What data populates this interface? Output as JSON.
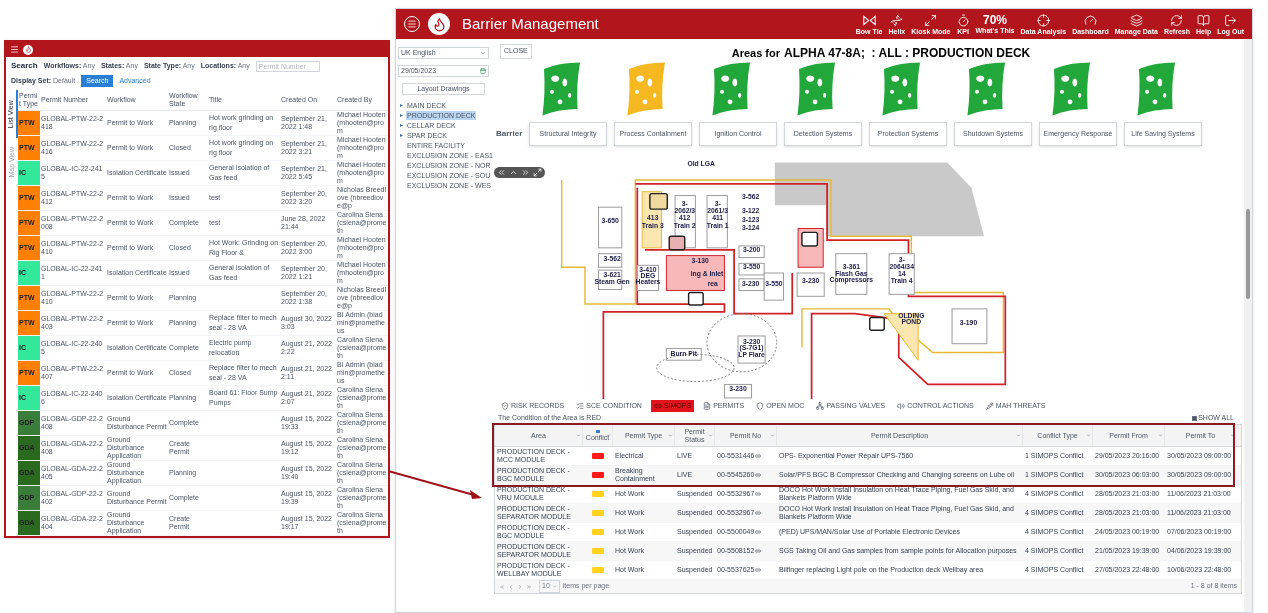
{
  "inset": {
    "search_label": "Search",
    "filters": [
      {
        "label": "Workflows:",
        "value": "Any"
      },
      {
        "label": "States:",
        "value": "Any"
      },
      {
        "label": "State Type:",
        "value": "Any"
      },
      {
        "label": "Locations:",
        "value": "Any"
      }
    ],
    "permit_number": {
      "placeholder": "Permit Number"
    },
    "display_set": {
      "label": "Display Set:",
      "value": "Default"
    },
    "search_button": "Search",
    "advanced_link": "Advanced",
    "side_tabs": [
      {
        "label": "List View",
        "selected": true
      },
      {
        "label": "Map View",
        "selected": false
      }
    ],
    "columns": [
      "Permit Type",
      "Permit Number",
      "Workflow",
      "Workflow State",
      "Title",
      "Created On",
      "Created By"
    ],
    "rows": [
      {
        "type": "PTW",
        "color": "#ff8000",
        "number": "GLOBAL-PTW-22-2418",
        "workflow": "Permit to Work",
        "state": "Planning",
        "title": "Hot work grinding on rig floor",
        "created": "September 21, 2022 1:48",
        "by": "Michael Hooten (mhooten@prom"
      },
      {
        "type": "PTW",
        "color": "#ff8000",
        "number": "GLOBAL-PTW-22-2416",
        "workflow": "Permit to Work",
        "state": "Closed",
        "title": "Hot work grinding on rig floor",
        "created": "September 21, 2022 3:21",
        "by": "Michael Hooten (mhooten@prom"
      },
      {
        "type": "IC",
        "color": "#33e89a",
        "number": "GLOBAL-IC-22-2415",
        "workflow": "Isolation Certificate",
        "state": "Issued",
        "title": "General isolation of Gas feed",
        "created": "September 21, 2022 5:45",
        "by": "Michael Hooten (mhooten@prom"
      },
      {
        "type": "PTW",
        "color": "#ff8000",
        "number": "GLOBAL-PTW-22-2412",
        "workflow": "Permit to Work",
        "state": "Issued",
        "title": "test",
        "created": "September 20, 2022 3:20",
        "by": "Nicholas Breedlove (nbreedlove@p"
      },
      {
        "type": "PTW",
        "color": "#ff8000",
        "number": "GLOBAL-PTW-22-2008",
        "workflow": "Permit to Work",
        "state": "Complete",
        "title": "test",
        "created": "June 28, 2022 21:44",
        "by": "Carolina Siena (csiena@prometh"
      },
      {
        "type": "PTW",
        "color": "#ff8000",
        "number": "GLOBAL-PTW-22-2410",
        "workflow": "Permit to Work",
        "state": "Closed",
        "title": "Hot Work: Grinding on Rig Floor &",
        "created": "September 20, 2022 3:00",
        "by": "Michael Hooten (mhooten@prom"
      },
      {
        "type": "IC",
        "color": "#33e89a",
        "number": "GLOBAL-IC-22-2411",
        "workflow": "Isolation Certificate",
        "state": "Issued",
        "title": "General isolation of Gas feed",
        "created": "September 20, 2022 1:21",
        "by": "Michael Hooten (mhooten@prom"
      },
      {
        "type": "PTW",
        "color": "#ff8000",
        "number": "GLOBAL-PTW-22-2410",
        "workflow": "Permit to Work",
        "state": "Planning",
        "title": "",
        "created": "September 20, 2022 1:38",
        "by": "Nicholas Breedlove (nbreedlove@p"
      },
      {
        "type": "PTW",
        "color": "#ff8000",
        "number": "GLOBAL-PTW-22-2403",
        "workflow": "Permit to Work",
        "state": "Planning",
        "title": "Replace filter to mech seal - 28 VA",
        "created": "August 30, 2022 3:03",
        "by": "BI Admin (biadmin@prometheus"
      },
      {
        "type": "IC",
        "color": "#33e89a",
        "number": "GLOBAL-IC-22-2405",
        "workflow": "Isolation Certificate",
        "state": "Complete",
        "title": "Electric pump relocation",
        "created": "August 21, 2022 2:22",
        "by": "Carolina Siena (csiena@prometh"
      },
      {
        "type": "PTW",
        "color": "#ff8000",
        "number": "GLOBAL-PTW-22-2407",
        "workflow": "Permit to Work",
        "state": "Closed",
        "title": "Replace filter to mech seal - 28 VA",
        "created": "August 21, 2022 2:11",
        "by": "BI Admin (biadmin@prometheus"
      },
      {
        "type": "IC",
        "color": "#33e89a",
        "number": "GLOBAL-IC-22-2406",
        "workflow": "Isolation Certificate",
        "state": "Planning",
        "title": "Board 61: Floor Sump Pumps",
        "created": "August 21, 2022 2:07",
        "by": "Carolina Siena (csiena@prometh"
      },
      {
        "type": "GDP",
        "color": "#3a7d3a",
        "number": "GLOBAL-GDP-22-2408",
        "workflow": "Ground Disturbance Permit",
        "state": "Complete",
        "title": "",
        "created": "August 15, 2022 19:33",
        "by": "Carolina Siena (csiena@prometh"
      },
      {
        "type": "GDA",
        "color": "#2a6a1e",
        "number": "GLOBAL-GDA-22-2408",
        "workflow": "Ground Disturbance Application",
        "state": "Create Permit",
        "title": "",
        "created": "August 15, 2022 19:12",
        "by": "Carolina Siena (csiena@prometh"
      },
      {
        "type": "GDA",
        "color": "#2a6a1e",
        "number": "GLOBAL-GDA-22-2405",
        "workflow": "Ground Disturbance Application",
        "state": "Planning",
        "title": "",
        "created": "August 15, 2022 19:40",
        "by": "Carolina Siena (csiena@prometh"
      },
      {
        "type": "GDP",
        "color": "#3a7d3a",
        "number": "GLOBAL-GDP-22-2402",
        "workflow": "Ground Disturbance Permit",
        "state": "Complete",
        "title": "",
        "created": "August 15, 2022 19:39",
        "by": "Carolina Siena (csiena@prometh"
      },
      {
        "type": "GDA",
        "color": "#2a6a1e",
        "number": "GLOBAL-GDA-22-2404",
        "workflow": "Ground Disturbance Application",
        "state": "Create Permit",
        "title": "",
        "created": "August 15, 2022 19:17",
        "by": "Carolina Siena (csiena@prometh"
      }
    ]
  },
  "app": {
    "title": "Barrier Management",
    "toolbar": [
      {
        "kind": "icon",
        "label": "Bow Tie"
      },
      {
        "kind": "icon",
        "label": "Helix"
      },
      {
        "kind": "icon",
        "label": "Kiosk Mode"
      },
      {
        "kind": "icon",
        "label": "KPI"
      },
      {
        "kind": "value",
        "value": "70%",
        "label": "What's This"
      },
      {
        "kind": "icon",
        "label": "Data Analysis"
      },
      {
        "kind": "icon",
        "label": "Dashboard"
      },
      {
        "kind": "icon",
        "label": "Manage Data"
      },
      {
        "kind": "icon",
        "label": "Refresh"
      },
      {
        "kind": "icon",
        "label": "Help"
      },
      {
        "kind": "icon",
        "label": "Log Out"
      }
    ]
  },
  "sidebar": {
    "language": "UK English",
    "date": "29/05/2023",
    "layout_button": "Layout Drawings",
    "tree": [
      {
        "label": "MAIN DECK",
        "has_children": true,
        "selected": false
      },
      {
        "label": "PRODUCTION DECK",
        "has_children": true,
        "selected": true
      },
      {
        "label": "CELLAR DECK",
        "has_children": true,
        "selected": false
      },
      {
        "label": "SPAR DECK",
        "has_children": true,
        "selected": false
      },
      {
        "label": "ENTIRE FACILITY",
        "has_children": false,
        "selected": false
      },
      {
        "label": "EXCLUSION ZONE - EAS1",
        "has_children": false,
        "selected": false
      },
      {
        "label": "EXCLUSION ZONE - NOR",
        "has_children": false,
        "selected": false
      },
      {
        "label": "EXCLUSION ZONE - SOU",
        "has_children": false,
        "selected": false
      },
      {
        "label": "EXCLUSION ZONE - WES",
        "has_children": false,
        "selected": false
      }
    ]
  },
  "areas": {
    "close_button": "CLOSE",
    "title_prefix": "Areas for",
    "title": "ALPHA 47-8A;  : ALL : PRODUCTION DECK",
    "barrier_label": "Barrier",
    "barriers": [
      {
        "label": "Structural Integrity",
        "color": "#22a83a"
      },
      {
        "label": "Process Containment",
        "color": "#f5b820"
      },
      {
        "label": "Ignition Control",
        "color": "#22a83a"
      },
      {
        "label": "Detection Systems",
        "color": "#22a83a"
      },
      {
        "label": "Protection Systems",
        "color": "#22a83a"
      },
      {
        "label": "Shutdown Systems",
        "color": "#22a83a"
      },
      {
        "label": "Emergency Response",
        "color": "#22a83a"
      },
      {
        "label": "Life Saving Systems",
        "color": "#22a83a"
      }
    ]
  },
  "map_labels": [
    "Old LGA",
    "3-650",
    "413",
    "Train 3",
    "3-",
    "2062/3",
    "412",
    "Train 2",
    "3-",
    "2061/3",
    "411",
    "Train 1",
    "3-562",
    "3-122",
    "3-123",
    "3-124",
    "3-200",
    "3-550",
    "3-230",
    "3-550",
    "3-230",
    "3-562",
    "3-621",
    "Steam Gen",
    "3-410",
    "DEG",
    "Heaters",
    "3-130",
    "ing & Inlet",
    "rea",
    "3-361",
    "Flash Gas",
    "Compressors",
    "3-",
    "2064/34",
    "14",
    "Train 4",
    "OLDING",
    "POND",
    "3-190",
    "Burn Pit",
    "3-230",
    "(S-7G1)",
    "LP Flare",
    "3-230"
  ],
  "tabs": [
    {
      "label": "RISK RECORDS",
      "selected": false
    },
    {
      "label": "SCE CONDITION",
      "selected": false
    },
    {
      "label": "SIMOPS",
      "selected": true
    },
    {
      "label": "PERMITS",
      "selected": false
    },
    {
      "label": "OPEN MOC",
      "selected": false
    },
    {
      "label": "PASSING VALVES",
      "selected": false
    },
    {
      "label": "CONTROL ACTIONS",
      "selected": false
    },
    {
      "label": "MAH THREATS",
      "selected": false
    }
  ],
  "condition_text": "The Condition of the Area is RED",
  "show_all": {
    "label": "SHOW ALL",
    "checked": true
  },
  "table": {
    "columns": [
      "Area",
      "Conflict",
      "Permit Type",
      "Permit Status",
      "Permit No",
      "Permit Description",
      "Conflict Type",
      "Permit From",
      "Permit To"
    ],
    "rows": [
      {
        "area": "PRODUCTION DECK - MCC MODULE",
        "color": "#ff1a1a",
        "type": "Electrical",
        "status": "LIVE",
        "no": "00-5531446",
        "desc": "OPS- Exponential Power Repair UPS-7560",
        "conflict": "1 SIMOPS Conflict",
        "from": "29/05/2023 20:16:00",
        "to": "30/05/2023 09:00:00"
      },
      {
        "area": "PRODUCTION DECK - BGC MODULE",
        "color": "#ff1a1a",
        "type": "Breaking Containment",
        "status": "LIVE",
        "no": "00-5545260",
        "desc": "Solar/PFS BGC B Compressor Checking and Changing screens on Lube oil",
        "conflict": "1 SIMOPS Conflict",
        "from": "30/05/2023 06:03:00",
        "to": "30/05/2023 09:00:00"
      },
      {
        "area": "PRODUCTION DECK - VRU MODULE",
        "color": "#ffd21f",
        "type": "Hot Work",
        "status": "Suspended",
        "no": "00-5532967",
        "desc": "DOCO Hot Work Install Insulation on Heat Trace Piping, Fuel Gas Skid, and Blankets Platform Wide",
        "conflict": "4 SIMOPS Conflict",
        "from": "28/05/2023 21:03:00",
        "to": "11/06/2023 21:03:00"
      },
      {
        "area": "PRODUCTION DECK - SEPARATOR MODULE",
        "color": "#ffd21f",
        "type": "Hot Work",
        "status": "Suspended",
        "no": "00-5532967",
        "desc": "DOCO Hot Work Install Insulation on Heat Trace Piping, Fuel Gas Skid, and Blankets Platform Wide",
        "conflict": "4 SIMOPS Conflict",
        "from": "28/05/2023 21:03:00",
        "to": "11/06/2023 21:03:00"
      },
      {
        "area": "PRODUCTION DECK - BGC MODULE",
        "color": "#ffd21f",
        "type": "Hot Work",
        "status": "Suspended",
        "no": "00-5500049",
        "desc": "(PED) UPS/MAN/Solar Use of Portable Electronic Devices",
        "conflict": "4 SIMOPS Conflict",
        "from": "24/05/2023 00:19:00",
        "to": "07/06/2023 00:19:00"
      },
      {
        "area": "PRODUCTION DECK - SEPARATOR MODULE",
        "color": "#ffd21f",
        "type": "Hot Work",
        "status": "Suspended",
        "no": "00-5508152",
        "desc": "SGS Taking Oil and Gas samples from sample points for Allocation purposes",
        "conflict": "4 SIMOPS Conflict",
        "from": "21/05/2023 19:39:00",
        "to": "04/06/2023 19:39:00"
      },
      {
        "area": "PRODUCTION DECK - WELLBAY MODULE",
        "color": "#ffd21f",
        "type": "Hot Work",
        "status": "Suspended",
        "no": "00-5537625",
        "desc": "Bilfinger replacing Light pole on the Production deck Wellbay area",
        "conflict": "4 SIMOPS Conflict",
        "from": "27/05/2023 22:48:00",
        "to": "10/06/2023 22:48:00"
      }
    ]
  },
  "pager": {
    "page_size": "10",
    "page_size_label": "items per page",
    "summary": "1 - 8 of 8 items"
  }
}
